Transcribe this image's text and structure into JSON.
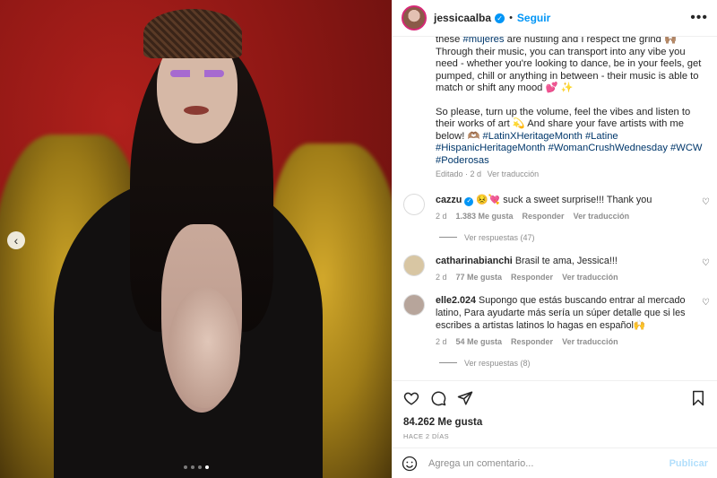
{
  "post": {
    "image_alt": "",
    "carousel": {
      "count": 4,
      "active": 3
    }
  },
  "header": {
    "username": "jessicaalba",
    "separator": "•",
    "follow_label": "Seguir",
    "more_label": "•••"
  },
  "caption": {
    "p1": [
      {
        "t": "these "
      },
      {
        "t": "#mujeres",
        "tag": true
      },
      {
        "t": " are hustling and I respect the grind 🙌🏽 Through their music, you can transport into any vibe you need - whether you're looking to dance, be in your feels, get pumped, chill or anything in between - their music is able to match or shift any mood 💕 ✨"
      }
    ],
    "p2": [
      {
        "t": "So please, turn up the volume, feel the vibes and listen to their works of art 💫 And share your fave artists with me below! 🫶🏽 "
      },
      {
        "t": "#LatinXHeritageMonth",
        "tag": true
      },
      {
        "t": " "
      },
      {
        "t": "#Latine",
        "tag": true
      },
      {
        "t": " "
      },
      {
        "t": "#HispanicHeritageMonth",
        "tag": true
      },
      {
        "t": " "
      },
      {
        "t": "#WomanCrushWednesday",
        "tag": true
      },
      {
        "t": " "
      },
      {
        "t": "#WCW",
        "tag": true
      },
      {
        "t": " "
      },
      {
        "t": "#Poderosas",
        "tag": true
      }
    ],
    "edited": "Editado · 2 d",
    "see_translation": "Ver traducción"
  },
  "comments": [
    {
      "username": "cazzu",
      "verified": true,
      "text": "😣💘 suck a sweet surprise!!! Thank you",
      "age": "2 d",
      "likes": "1.383 Me gusta",
      "reply": "Responder",
      "translate": "Ver traducción",
      "replies": "Ver respuestas (47)",
      "avatar_color": "#ffffff"
    },
    {
      "username": "catharinabianchi",
      "verified": false,
      "text": "Brasil te ama, Jessica!!!",
      "age": "2 d",
      "likes": "77 Me gusta",
      "reply": "Responder",
      "translate": "Ver traducción",
      "replies": "",
      "avatar_color": "#d8c6a3"
    },
    {
      "username": "elle2.024",
      "verified": false,
      "text": "Supongo que estás buscando entrar al mercado latino, Para ayudarte más sería un súper detalle que si les escribes a artistas latinos lo hagas en español🙌",
      "age": "2 d",
      "likes": "54 Me gusta",
      "reply": "Responder",
      "translate": "Ver traducción",
      "replies": "Ver respuestas (8)",
      "avatar_color": "#b7a59b"
    }
  ],
  "footer": {
    "likes": "84.262 Me gusta",
    "ago": "HACE 2 DÍAS",
    "comment_placeholder": "Agrega un comentario...",
    "publish_label": "Publicar"
  },
  "colors": {
    "accent": "#0095f6",
    "hashtag": "#00376b",
    "muted": "#8e8e8e"
  }
}
